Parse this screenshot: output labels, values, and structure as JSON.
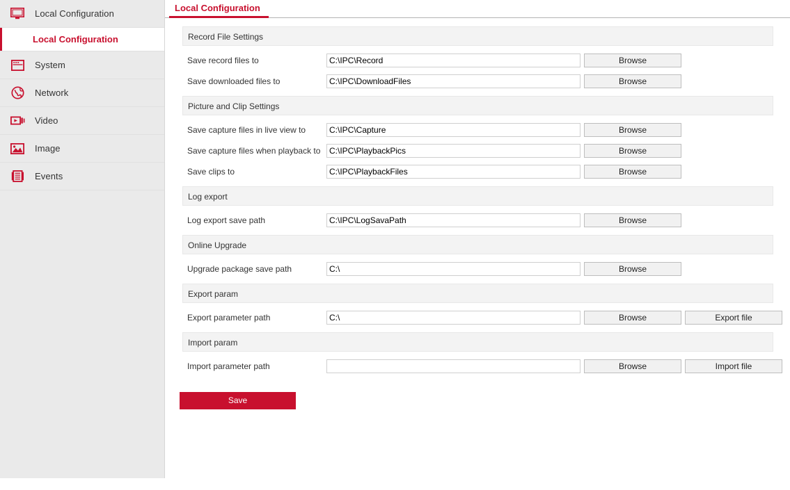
{
  "sidebar": {
    "items": [
      {
        "label": "Local Configuration",
        "icon": "monitor-icon",
        "key": "local-configuration"
      },
      {
        "label": "System",
        "icon": "system-window-icon",
        "key": "system"
      },
      {
        "label": "Network",
        "icon": "globe-icon",
        "key": "network"
      },
      {
        "label": "Video",
        "icon": "video-camera-icon",
        "key": "video"
      },
      {
        "label": "Image",
        "icon": "picture-icon",
        "key": "image"
      },
      {
        "label": "Events",
        "icon": "events-list-icon",
        "key": "events"
      }
    ],
    "sub_item": {
      "label": "Local Configuration",
      "active": true
    }
  },
  "tab": {
    "label": "Local Configuration"
  },
  "colors": {
    "accent": "#c8102e",
    "sidebar_bg": "#eaeaea",
    "section_bg": "#f3f3f3",
    "button_bg": "#f1f1f1"
  },
  "buttons": {
    "browse": "Browse",
    "export_file": "Export file",
    "import_file": "Import file",
    "save": "Save"
  },
  "sections": [
    {
      "title": "Record File Settings",
      "fields": [
        {
          "label": "Save record files to",
          "value": "C:\\IPC\\Record",
          "placeholder": "",
          "buttons": [
            "Browse"
          ]
        },
        {
          "label": "Save downloaded files to",
          "value": "C:\\IPC\\DownloadFiles",
          "placeholder": "",
          "buttons": [
            "Browse"
          ]
        }
      ]
    },
    {
      "title": "Picture and Clip Settings",
      "fields": [
        {
          "label": "Save capture files in live view to",
          "value": "C:\\IPC\\Capture",
          "placeholder": "",
          "buttons": [
            "Browse"
          ]
        },
        {
          "label": "Save capture files when playback to",
          "value": "C:\\IPC\\PlaybackPics",
          "placeholder": "",
          "buttons": [
            "Browse"
          ]
        },
        {
          "label": "Save clips to",
          "value": "C:\\IPC\\PlaybackFiles",
          "placeholder": "",
          "buttons": [
            "Browse"
          ]
        }
      ]
    },
    {
      "title": "Log export",
      "fields": [
        {
          "label": "Log export save path",
          "value": "C:\\IPC\\LogSavaPath",
          "placeholder": "",
          "buttons": [
            "Browse"
          ]
        }
      ]
    },
    {
      "title": "Online Upgrade",
      "fields": [
        {
          "label": "Upgrade package save path",
          "value": "C:\\",
          "placeholder": "",
          "buttons": [
            "Browse"
          ]
        }
      ]
    },
    {
      "title": "Export param",
      "fields": [
        {
          "label": "Export parameter path",
          "value": "C:\\",
          "placeholder": "",
          "buttons": [
            "Browse",
            "Export file"
          ]
        }
      ]
    },
    {
      "title": "Import param",
      "fields": [
        {
          "label": "Import parameter path",
          "value": "",
          "placeholder": "",
          "buttons": [
            "Browse",
            "Import file"
          ]
        }
      ]
    }
  ]
}
